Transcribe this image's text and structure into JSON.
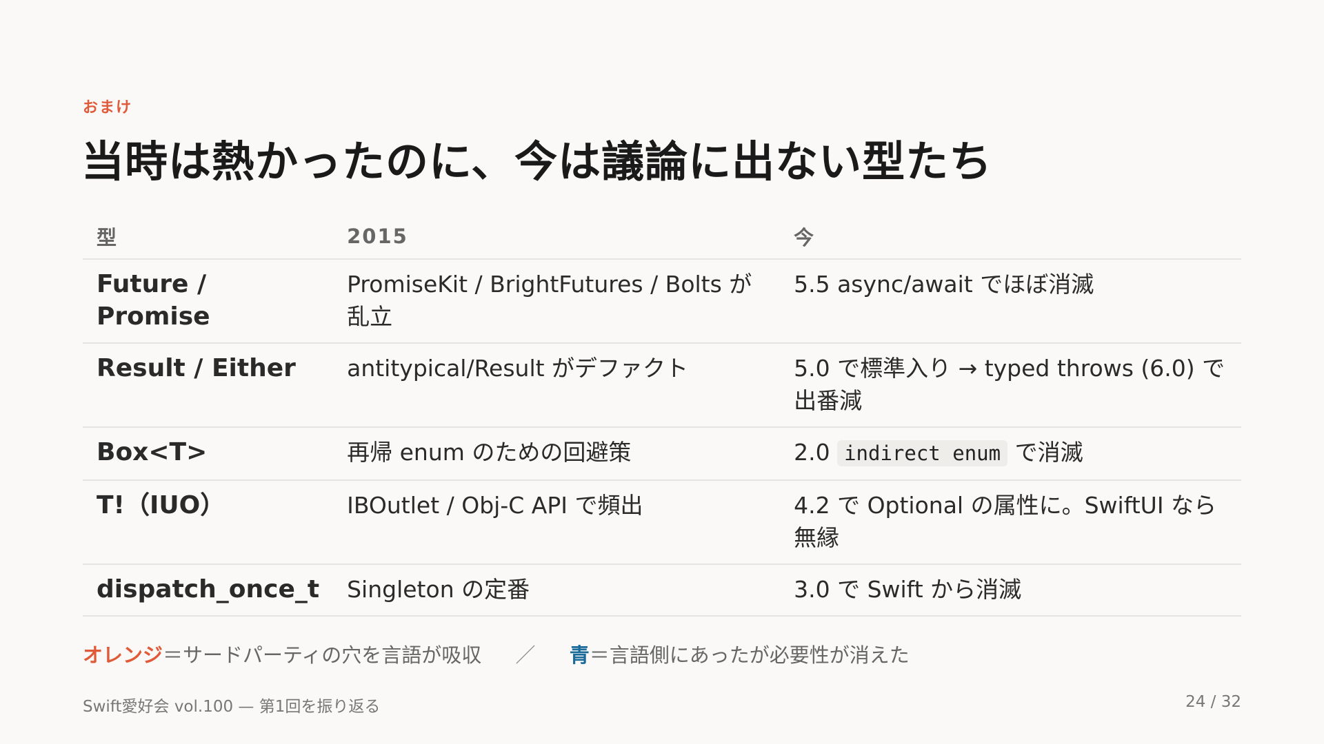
{
  "slide": {
    "eyebrow": "おまけ",
    "title": "当時は熱かったのに、今は議論に出ない型たち"
  },
  "table": {
    "headers": [
      "型",
      "2015",
      "今"
    ],
    "rows": [
      {
        "type": "Future / Promise",
        "color": "orange",
        "y2015": "PromiseKit / BrightFutures / Bolts が乱立",
        "now": "5.5 async/await でほぼ消滅"
      },
      {
        "type": "Result / Either",
        "color": "orange",
        "y2015": "antitypical/Result がデファクト",
        "now": "5.0 で標準入り → typed throws (6.0) で出番減"
      },
      {
        "type": "Box<T>",
        "color": "orange",
        "y2015": "再帰 enum のための回避策",
        "now_prefix": "2.0",
        "now_code": "indirect enum",
        "now_suffix": "で消滅"
      },
      {
        "type": "T!（IUO）",
        "color": "blue",
        "y2015": "IBOutlet / Obj-C API で頻出",
        "now": "4.2 で Optional の属性に。SwiftUI なら無縁"
      },
      {
        "type": "dispatch_once_t",
        "color": "blue",
        "y2015": "Singleton の定番",
        "now": "3.0 で Swift から消滅"
      }
    ]
  },
  "legend": {
    "orange_key": "オレンジ",
    "orange_text": "＝サードパーティの穴を言語が吸収",
    "separator": "／",
    "blue_key": "青",
    "blue_text": "＝言語側にあったが必要性が消えた"
  },
  "footer": {
    "left": "Swift愛好会 vol.100 — 第1回を振り返る",
    "page": "24 / 32"
  },
  "colors": {
    "accent_orange": "#e05a3a",
    "accent_blue": "#1a6a9a",
    "background": "#faf9f7",
    "divider": "#e6e4e0"
  }
}
